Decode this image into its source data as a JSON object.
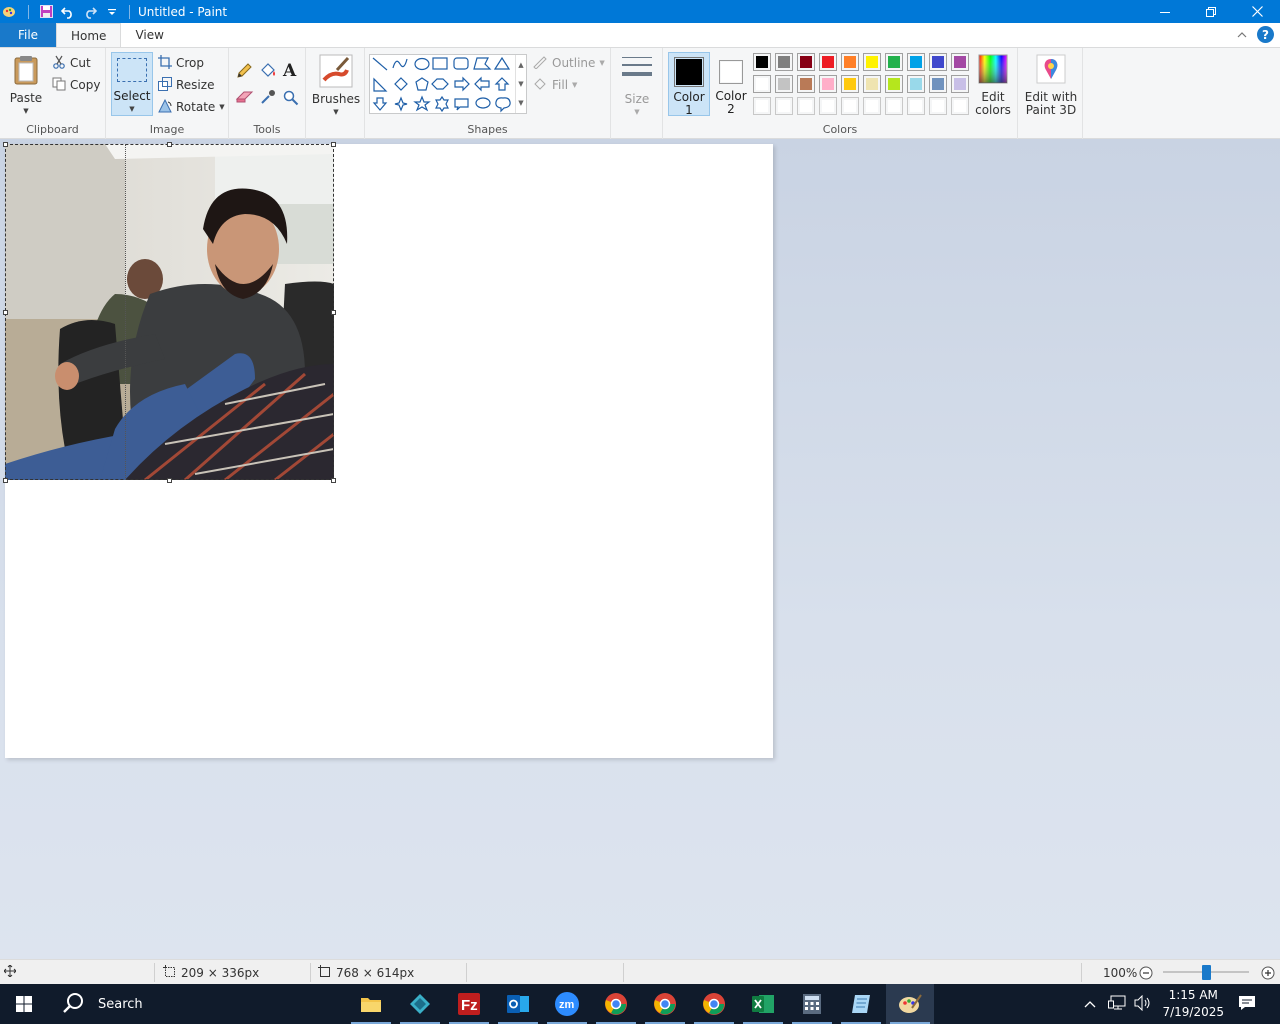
{
  "window": {
    "title": "Untitled - Paint"
  },
  "tabs": {
    "file": "File",
    "home": "Home",
    "view": "View"
  },
  "clipboard": {
    "paste": "Paste",
    "cut": "Cut",
    "copy": "Copy",
    "label": "Clipboard"
  },
  "image": {
    "select": "Select",
    "crop": "Crop",
    "resize": "Resize",
    "rotate": "Rotate",
    "label": "Image"
  },
  "tools": {
    "label": "Tools"
  },
  "brushes": {
    "label": "Brushes"
  },
  "shapes": {
    "outline": "Outline",
    "fill": "Fill",
    "label": "Shapes"
  },
  "size": {
    "label": "Size"
  },
  "colors": {
    "color1_line1": "Color",
    "color1_line2": "1",
    "color2_line1": "Color",
    "color2_line2": "2",
    "edit_line1": "Edit",
    "edit_line2": "colors",
    "label": "Colors",
    "color1_value": "#000000",
    "color2_value": "#ffffff",
    "palette_row1": [
      "#000000",
      "#7f7f7f",
      "#880015",
      "#ed1c24",
      "#ff7f27",
      "#fff200",
      "#22b14c",
      "#00a2e8",
      "#3f48cc",
      "#a349a4"
    ],
    "palette_row2": [
      "#ffffff",
      "#c3c3c3",
      "#b97a57",
      "#ffaec9",
      "#ffc90e",
      "#efe4b0",
      "#b5e61d",
      "#99d9ea",
      "#7092be",
      "#c8bfe7"
    ],
    "palette_row3": [
      "#ffffff",
      "#ffffff",
      "#ffffff",
      "#ffffff",
      "#ffffff",
      "#ffffff",
      "#ffffff",
      "#ffffff",
      "#ffffff",
      "#ffffff"
    ]
  },
  "paint3d": {
    "line1": "Edit with",
    "line2": "Paint 3D"
  },
  "status": {
    "selection_size": "209 × 336px",
    "canvas_size": "768 × 614px",
    "zoom": "100%"
  },
  "taskbar": {
    "search": "Search",
    "time": "1:15 AM",
    "date": "7/19/2025"
  }
}
